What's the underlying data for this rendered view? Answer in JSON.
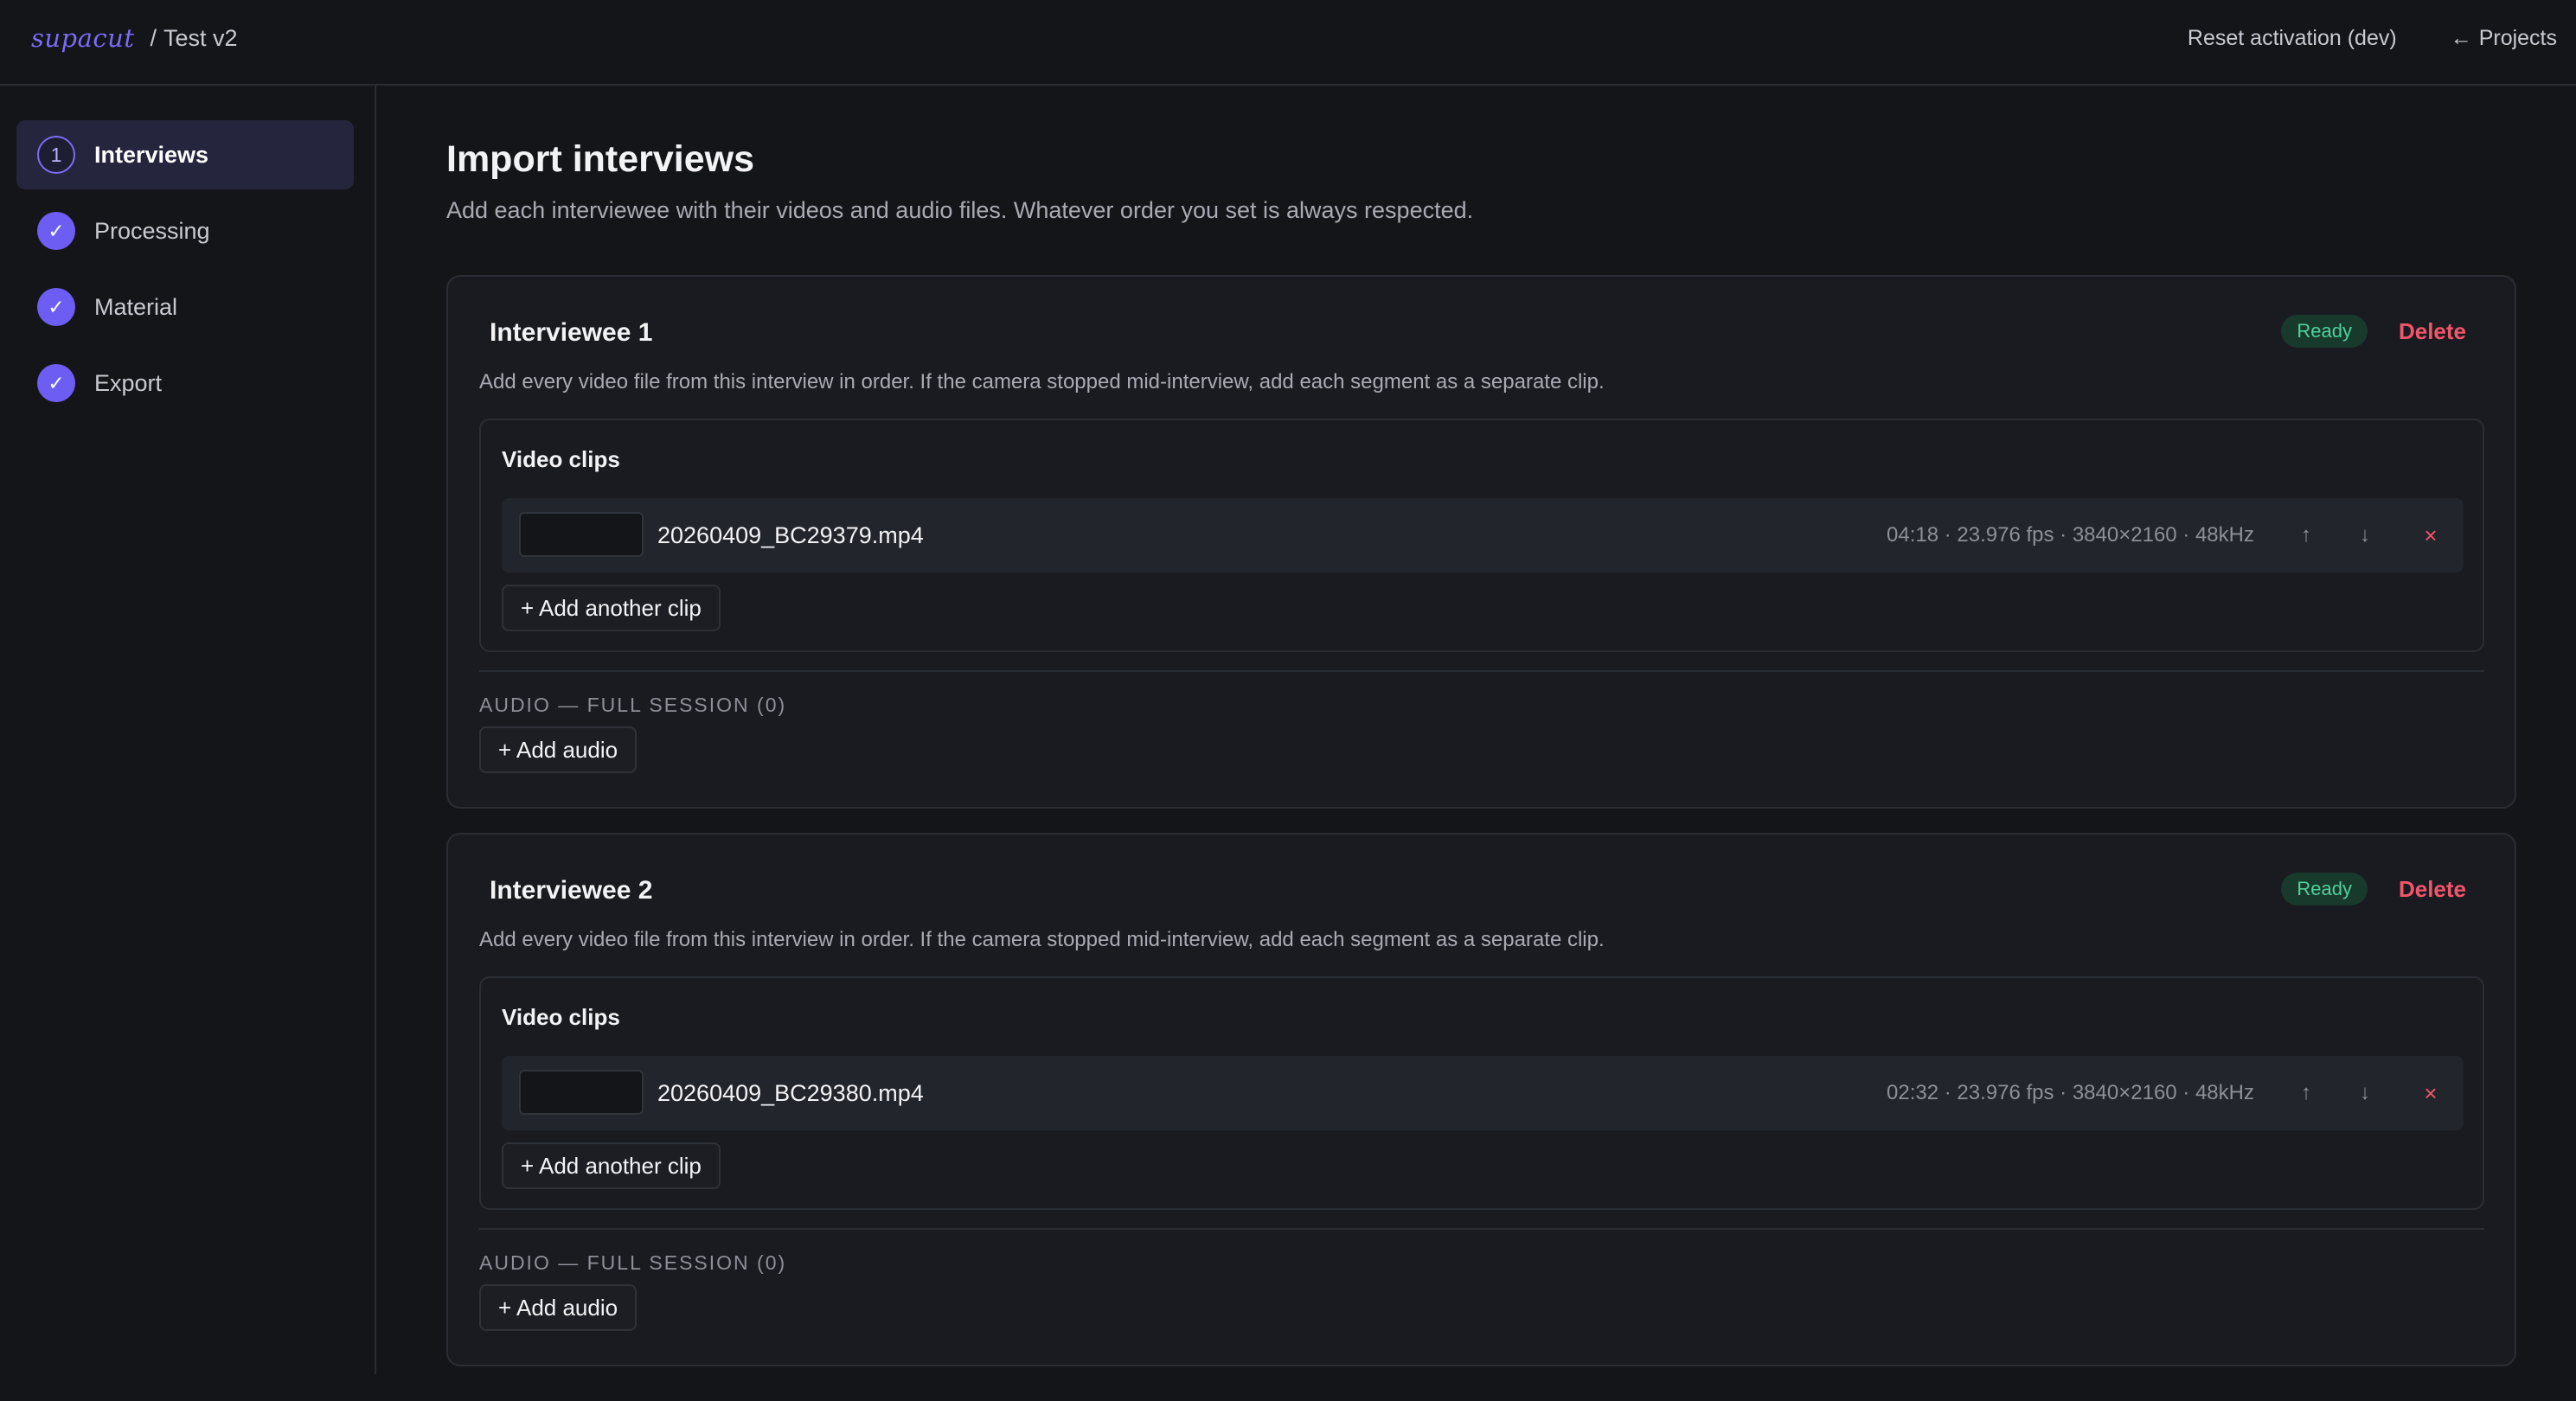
{
  "header": {
    "logo": "supacut",
    "separator": "/",
    "project": "Test v2",
    "reset_label": "Reset activation (dev)",
    "projects_label": "Projects",
    "projects_icon": "arrow-left-icon"
  },
  "sidebar": {
    "steps": [
      {
        "marker": "1",
        "label": "Interviews",
        "state": "active"
      },
      {
        "marker": "✓",
        "label": "Processing",
        "state": "done"
      },
      {
        "marker": "✓",
        "label": "Material",
        "state": "done"
      },
      {
        "marker": "✓",
        "label": "Export",
        "state": "done"
      }
    ]
  },
  "main": {
    "title": "Import interviews",
    "subtitle": "Add each interviewee with their videos and audio files. Whatever order you set is always respected.",
    "interviewees": [
      {
        "title": "Interviewee 1",
        "status": "Ready",
        "delete_label": "Delete",
        "description": "Add every video file from this interview in order. If the camera stopped mid-interview, add each segment as a separate clip.",
        "clips_title": "Video clips",
        "clip": {
          "name": "20260409_BC29379.mp4",
          "meta": "04:18 · 23.976 fps · 3840×2160 · 48kHz",
          "up": "↑",
          "down": "↓",
          "remove": "×"
        },
        "add_clip_label": "+ Add another clip",
        "audio_label": "AUDIO — FULL SESSION (0)",
        "add_audio_label": "+ Add audio"
      },
      {
        "title": "Interviewee 2",
        "status": "Ready",
        "delete_label": "Delete",
        "description": "Add every video file from this interview in order. If the camera stopped mid-interview, add each segment as a separate clip.",
        "clips_title": "Video clips",
        "clip": {
          "name": "20260409_BC29380.mp4",
          "meta": "02:32 · 23.976 fps · 3840×2160 · 48kHz",
          "up": "↑",
          "down": "↓",
          "remove": "×"
        },
        "add_clip_label": "+ Add another clip",
        "audio_label": "AUDIO — FULL SESSION (0)",
        "add_audio_label": "+ Add audio"
      }
    ]
  },
  "colors": {
    "background": "#141519",
    "accent": "#7b6cf6",
    "ready_bg": "#183a2d",
    "ready_text": "#4fd19a",
    "danger": "#f0566a"
  }
}
